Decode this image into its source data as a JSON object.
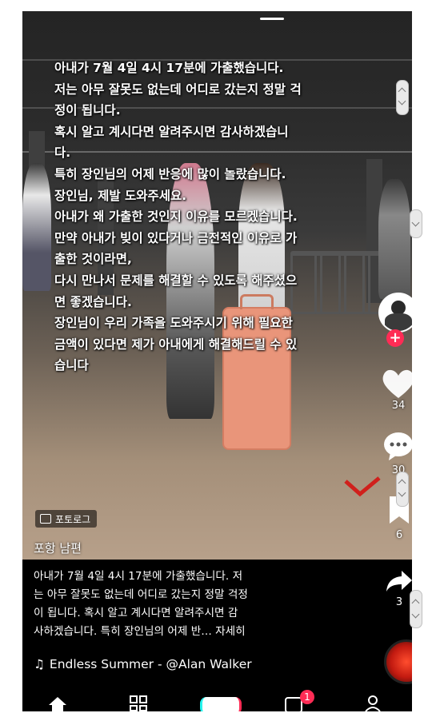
{
  "overlay": {
    "lines": [
      "아내가 7월 4일 4시 17분에 가출했습니다.",
      "저는 아무 잘못도 없는데 어디로 갔는지 정말 걱",
      "정이 됩니다.",
      "혹시 알고 계시다면 알려주시면 감사하겠습니",
      "다.",
      "특히 장인님의 어제 반응에 많이 놀랐습니다.",
      "장인님, 제발 도와주세요.",
      "아내가 왜 가출한 것인지 이유를 모르겠습니다.",
      "만약 아내가 빚이 있다거나 금전적인 이유로 가",
      "출한 것이라면,",
      "다시 만나서 문제를 해결할 수 있도록 해주셨으",
      "면 좋겠습니다.",
      "장인님이 우리 가족을 도와주시기 위해 필요한",
      "금액이 있다면 제가 아내에게 해결해드릴 수 있",
      "습니다"
    ]
  },
  "badge": {
    "label": "포토로그"
  },
  "author": {
    "name": "포항 남편"
  },
  "caption": {
    "lines": [
      "아내가 7월 4일 4시 17분에 가출했습니다.  저",
      "는 아무 잘못도 없는데 어디로 갔는지 정말 걱정",
      "이 됩니다.  혹시 알고 계시다면 알려주시면 감",
      "사하겠습니다.  특히 장인님의 어제 반…"
    ],
    "more": "자세히"
  },
  "music": {
    "icon": "music-note-icon",
    "title": "Endless Summer - @Alan Walker"
  },
  "rail": {
    "like_count": "34",
    "comment_count": "30",
    "save_count": "6",
    "share_count": "3"
  },
  "nav": {
    "inbox_badge": "1"
  },
  "colors": {
    "accent": "#ff2c55",
    "suitcase": "#e9957a"
  }
}
